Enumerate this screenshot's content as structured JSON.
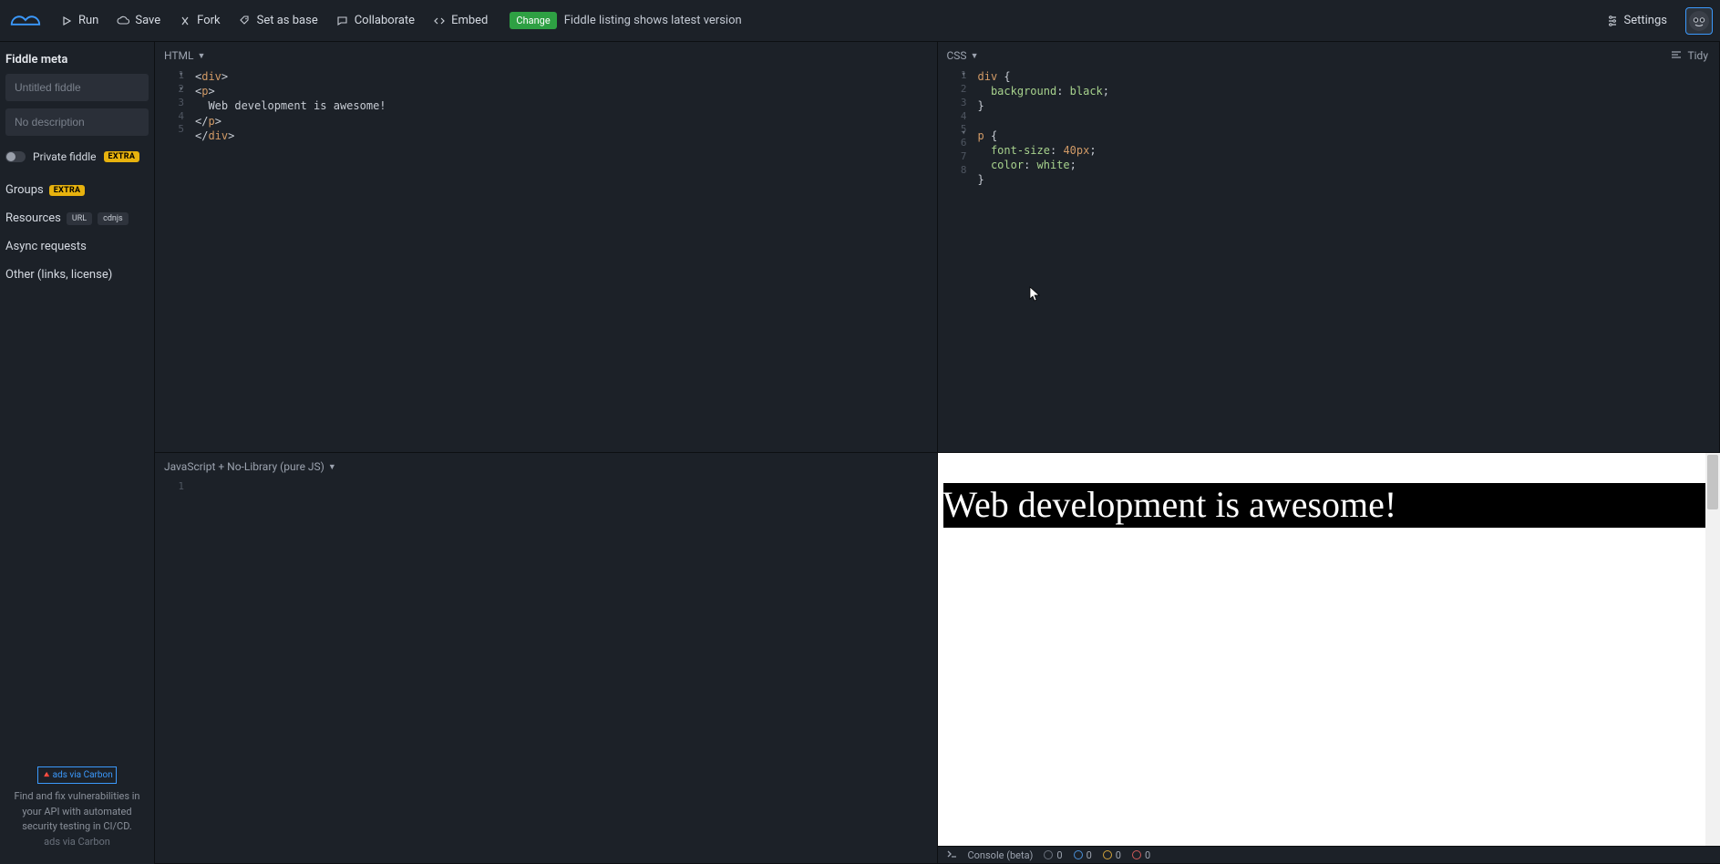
{
  "topbar": {
    "run": "Run",
    "save": "Save",
    "fork": "Fork",
    "set_as_base": "Set as base",
    "collaborate": "Collaborate",
    "embed": "Embed",
    "change_badge": "Change",
    "change_text": "Fiddle listing shows latest version",
    "settings": "Settings"
  },
  "sidebar": {
    "meta_title": "Fiddle meta",
    "title_placeholder": "Untitled fiddle",
    "desc_placeholder": "No description",
    "private_label": "Private fiddle",
    "extra_badge": "EXTRA",
    "groups": "Groups",
    "resources": "Resources",
    "url_badge": "URL",
    "cdnjs_badge": "cdnjs",
    "async": "Async requests",
    "other": "Other (links, license)",
    "ad_link": "ads via Carbon",
    "ad_text": "Find and fix vulnerabilities in your API with automated security testing in CI/CD.",
    "ad_caption": "ads via Carbon"
  },
  "panels": {
    "html_label": "HTML",
    "css_label": "CSS",
    "js_label": "JavaScript + No-Library (pure JS)",
    "tidy": "Tidy"
  },
  "html_code": {
    "lines": [
      "1",
      "2",
      "3",
      "4",
      "5"
    ],
    "l1_open": "<",
    "l1_tag": "div",
    "l1_close": ">",
    "l2_open": "<",
    "l2_tag": "p",
    "l2_close": ">",
    "l3_text": "  Web development is awesome!",
    "l4_open": "</",
    "l4_tag": "p",
    "l4_close": ">",
    "l5_open": "</",
    "l5_tag": "div",
    "l5_close": ">"
  },
  "css_code": {
    "lines": [
      "1",
      "2",
      "3",
      "4",
      "5",
      "6",
      "7",
      "8"
    ],
    "l1_sel": "div",
    "l1_brace": " {",
    "l2_prop": "  background",
    "l2_colon": ": ",
    "l2_val": "black",
    "l2_semi": ";",
    "l3_brace": "}",
    "l5_sel": "p",
    "l5_brace": " {",
    "l6_prop": "  font-size",
    "l6_colon": ": ",
    "l6_val": "40px",
    "l6_semi": ";",
    "l7_prop": "  color",
    "l7_colon": ": ",
    "l7_val": "white",
    "l7_semi": ";",
    "l8_brace": "}"
  },
  "js_code": {
    "lines": [
      "1"
    ]
  },
  "result": {
    "text": "Web development is awesome!"
  },
  "console": {
    "label": "Console (beta)",
    "zero": "0"
  }
}
